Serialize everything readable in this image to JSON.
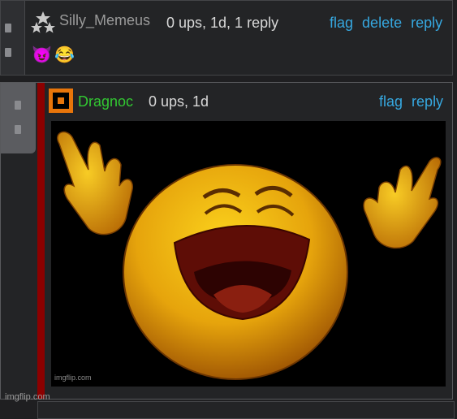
{
  "comments": [
    {
      "username": "Silly_Memeus",
      "meta": "0 ups, 1d, 1 reply",
      "actions": [
        "flag",
        "delete",
        "reply"
      ],
      "body_emoji": [
        "😈",
        "😂"
      ],
      "user_icon": "two-stars-icon"
    },
    {
      "username": "Dragnoc",
      "meta": "0 ups, 1d",
      "actions": [
        "flag",
        "reply"
      ],
      "user_icon": "orange-square-avatar-icon",
      "image_watermark": "imgflip.com"
    }
  ],
  "footer_watermark": "imgflip.com",
  "colors": {
    "link": "#36a8e0",
    "username_green": "#32c832",
    "thread_bar": "#8c0000",
    "avatar": "#e8750a"
  }
}
